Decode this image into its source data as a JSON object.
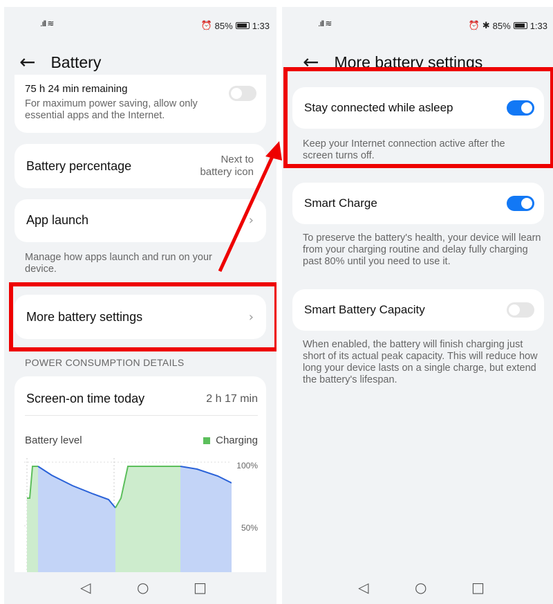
{
  "status": {
    "signal": "ᴵᴵᴵ ≈",
    "alarm": "⏰",
    "bluetooth": "✱",
    "battery_pct": "85%",
    "time": "1:33"
  },
  "left": {
    "title": "Battery",
    "power_saving": {
      "remaining": "75 h 24 min remaining",
      "desc": "For maximum power saving, allow only essential apps and the Internet.",
      "enabled": false
    },
    "battery_percentage": {
      "label": "Battery percentage",
      "value_line1": "Next to",
      "value_line2": "battery icon"
    },
    "app_launch": {
      "label": "App launch",
      "desc": "Manage how apps launch and run on your device."
    },
    "more_settings": {
      "label": "More battery settings"
    },
    "section_header": "POWER CONSUMPTION DETAILS",
    "screen_on": {
      "label": "Screen-on time today",
      "value": "2 h 17 min"
    },
    "battery_level": {
      "label": "Battery level",
      "legend": "Charging",
      "tick_100": "100%",
      "tick_50": "50%"
    }
  },
  "right": {
    "title": "More battery settings",
    "stay_connected": {
      "label": "Stay connected while asleep",
      "desc": "Keep your Internet connection active after the screen turns off.",
      "enabled": true
    },
    "smart_charge": {
      "label": "Smart Charge",
      "desc": "To preserve the battery's health, your device will learn from your charging routine and delay fully charging past 80% until you need to use it.",
      "enabled": true
    },
    "smart_capacity": {
      "label": "Smart Battery Capacity",
      "desc": "When enabled, the battery will finish charging just short of its actual peak capacity. This will reduce how long your device lasts on a single charge, but extend the battery's lifespan.",
      "enabled": false
    }
  },
  "nav": {
    "back": "◁",
    "home": "○",
    "recents": "□"
  },
  "colors": {
    "accent": "#1278f5",
    "highlight": "#ee0000",
    "charging": "#5cbf5c"
  }
}
